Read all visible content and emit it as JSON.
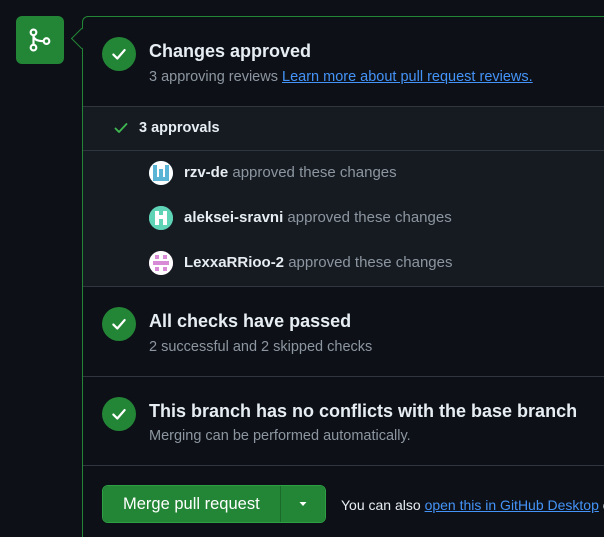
{
  "colors": {
    "background": "#0d1117",
    "success": "#238636",
    "link": "#4493f8",
    "muted": "#8d96a0",
    "border": "#30363d"
  },
  "badge": {
    "icon": "git-merge-icon"
  },
  "review": {
    "title": "Changes approved",
    "subtitle_prefix": "3 approving reviews ",
    "learn_more_link": "Learn more about pull request reviews."
  },
  "approvals": {
    "label": "3 approvals",
    "reviewers": [
      {
        "name": "rzv-de",
        "action": " approved these changes",
        "avatar_color": "#5ab4d6"
      },
      {
        "name": "aleksei-sravni",
        "action": " approved these changes",
        "avatar_color": "#5fd3b6"
      },
      {
        "name": "LexxaRRioo-2",
        "action": " approved these changes",
        "avatar_color": "#d98ad6"
      }
    ]
  },
  "checks": {
    "title": "All checks have passed",
    "subtitle": "2 successful and 2 skipped checks"
  },
  "conflicts": {
    "title": "This branch has no conflicts with the base branch",
    "subtitle": "Merging can be performed automatically."
  },
  "merge": {
    "button_label": "Merge pull request",
    "also_prefix": "You can also ",
    "desktop_link": "open this in GitHub Desktop",
    "also_suffix": " o"
  }
}
